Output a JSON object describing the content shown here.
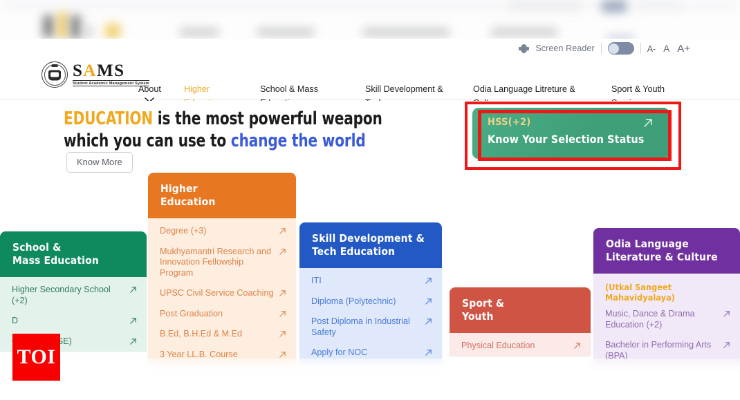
{
  "accessibility_bar": {
    "screen_reader_label": "Screen Reader",
    "toggle_state": "off",
    "font_decrease": "A-",
    "font_normal": "A",
    "font_increase": "A+"
  },
  "brand": {
    "name": "SAMS",
    "name_letter_1": "S",
    "name_letter_2": "A",
    "name_letter_3": "MS",
    "subtitle": "Student Academic Management System"
  },
  "nav": {
    "items": [
      {
        "label": "About",
        "has_caret": true,
        "active": false
      },
      {
        "label_line1": "Higher",
        "label_line2": "Education",
        "has_caret": true,
        "active": true
      },
      {
        "label_line1": "School & Mass",
        "label_line2": "Education",
        "has_caret": true,
        "active": false
      },
      {
        "label_line1": "Skill Development &",
        "label_line2": "Tech",
        "has_caret": true,
        "active": false
      },
      {
        "label_line1": "Odia Language Litreture &",
        "label_line2": "Culture",
        "has_caret": true,
        "active": false
      },
      {
        "label_line1": "Sport & Youth",
        "label_line2": "Service",
        "has_caret": true,
        "active": false
      }
    ]
  },
  "hero": {
    "line1_highlight": "EDUCATION",
    "line1_rest": " is the most powerful weapon",
    "line2_start": "which you can use to ",
    "line2_link": "change the world",
    "cta_label": "Know More"
  },
  "highlight_tile": {
    "eyebrow": "HSS(+2)",
    "title": "Know Your Selection Status",
    "arrow": "↗",
    "annotation_color": "#ef1616",
    "tile_color": "#3ea079"
  },
  "cards": [
    {
      "id": "school",
      "title_line1": "School &",
      "title_line2": "Mass Education",
      "header_color": "#0f8a5f",
      "links": [
        "Higher Secondary School (+2)",
        "D",
        "C                  ence (CHSE)"
      ]
    },
    {
      "id": "higher",
      "title_line1": "Higher",
      "title_line2": "Education",
      "header_color": "#e87722",
      "links": [
        "Degree (+3)",
        "Mukhyamantri Research and Innovation Fellowship Program",
        "UPSC Civil Service Coaching",
        "Post Graduation",
        "B.Ed, B.H.Ed & M.Ed",
        "3 Year LL.B. Course"
      ]
    },
    {
      "id": "skill",
      "title_line1": "Skill Development &",
      "title_line2": "Tech Education",
      "header_color": "#2259c4",
      "links": [
        "ITI",
        "Diploma (Polytechnic)",
        "Post Diploma in Industrial Safety",
        "Apply for NOC"
      ]
    },
    {
      "id": "sport",
      "title_line1": "Sport &",
      "title_line2": "Youth",
      "header_color": "#d05443",
      "links": [
        "Physical Education"
      ]
    },
    {
      "id": "odia",
      "title_line1": "Odia Language",
      "title_line2": "Literature & Culture",
      "header_color": "#7030a0",
      "note": "(Utkal Sangeet Mahavidyalaya)",
      "links": [
        "Music, Dance & Drama Education (+2)",
        "Bachelor in Performing Arts (BPA)"
      ]
    }
  ],
  "watermark": {
    "text": "TOI",
    "background_color": "#f90000"
  }
}
